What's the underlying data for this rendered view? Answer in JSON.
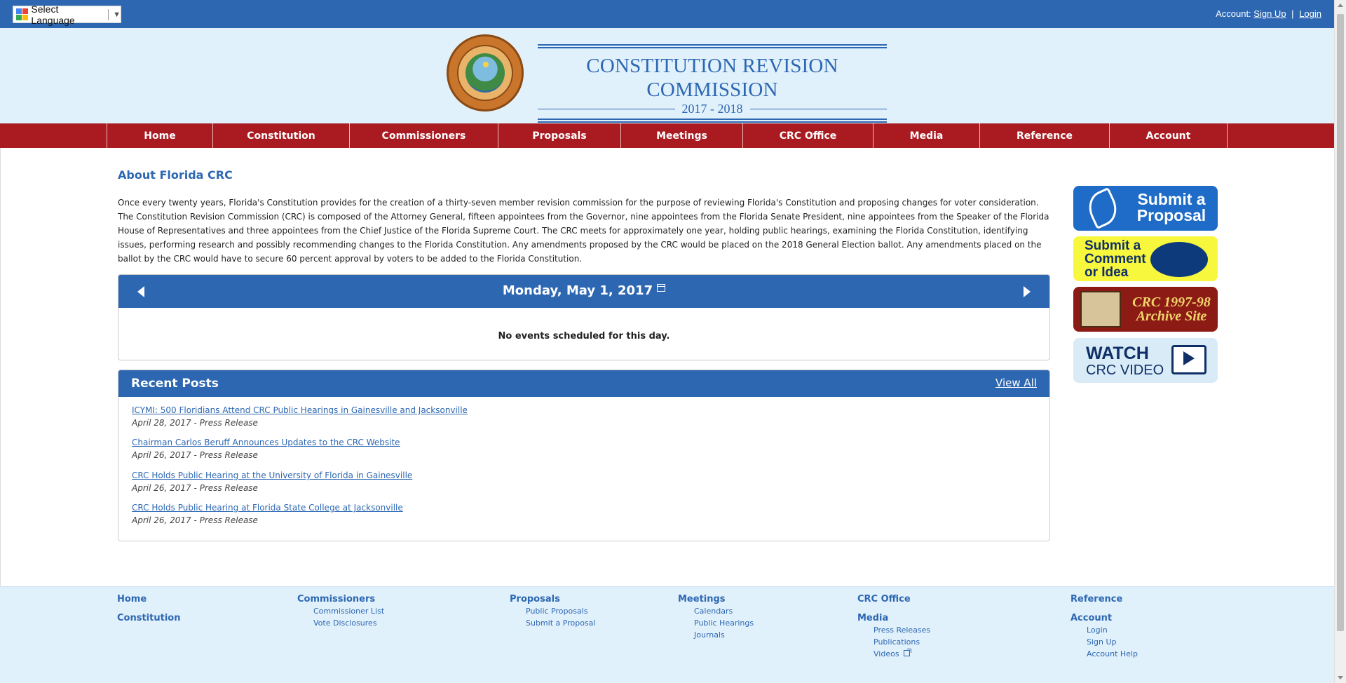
{
  "topbar": {
    "language_label": "Select Language",
    "account_label": "Account:",
    "signup": "Sign Up",
    "login": "Login",
    "separator": "|"
  },
  "header": {
    "title": "CONSTITUTION REVISION COMMISSION",
    "years": "2017 - 2018",
    "seal_text": "GREAT SEAL OF THE STATE OF FLORIDA · IN GOD WE TRUST"
  },
  "nav": [
    "Home",
    "Constitution",
    "Commissioners",
    "Proposals",
    "Meetings",
    "CRC Office",
    "Media",
    "Reference",
    "Account"
  ],
  "about": {
    "title": "About Florida CRC",
    "body": "Once every twenty years, Florida's Constitution provides for the creation of a thirty-seven member revision commission for the purpose of reviewing Florida's Constitution and proposing changes for voter consideration. The Constitution Revision Commission (CRC) is composed of the Attorney General, fifteen appointees from the Governor, nine appointees from the Florida Senate President, nine appointees from the Speaker of the Florida House of Representatives and three appointees from the Chief Justice of the Florida Supreme Court. The CRC meets for approximately one year, holding public hearings, examining the Florida Constitution, identifying issues, performing research and possibly recommending changes to the Florida Constitution. Any amendments proposed by the CRC would be placed on the 2018 General Election ballot. Any amendments placed on the ballot by the CRC would have to secure 60 percent approval by voters to be added to the Florida Constitution."
  },
  "calendar": {
    "date": "Monday, May 1, 2017",
    "empty_message": "No events scheduled for this day."
  },
  "recent_posts": {
    "title": "Recent Posts",
    "view_all": "View All",
    "items": [
      {
        "title": "ICYMI: 500 Floridians Attend CRC Public Hearings in Gainesville and Jacksonville",
        "meta": "April 28, 2017 - Press Release"
      },
      {
        "title": "Chairman Carlos Beruff Announces Updates to the CRC Website",
        "meta": "April 26, 2017 - Press Release"
      },
      {
        "title": "CRC Holds Public Hearing at the University of Florida in Gainesville",
        "meta": "April 26, 2017 - Press Release"
      },
      {
        "title": "CRC Holds Public Hearing at Florida State College at Jacksonville",
        "meta": "April 26, 2017 - Press Release"
      }
    ]
  },
  "sidebar": {
    "submit_proposal": "Submit a Proposal",
    "submit_comment": "Submit a Comment or Idea",
    "archive": "CRC 1997-98 Archive Site",
    "watch_1": "WATCH",
    "watch_2": "CRC VIDEO"
  },
  "footer": {
    "home": "Home",
    "constitution": "Constitution",
    "commissioners": {
      "head": "Commissioners",
      "items": [
        "Commissioner List",
        "Vote Disclosures"
      ]
    },
    "proposals": {
      "head": "Proposals",
      "items": [
        "Public Proposals",
        "Submit a Proposal"
      ]
    },
    "meetings": {
      "head": "Meetings",
      "items": [
        "Calendars",
        "Public Hearings",
        "Journals"
      ]
    },
    "crc_office": "CRC Office",
    "media": {
      "head": "Media",
      "items": [
        "Press Releases",
        "Publications",
        "Videos"
      ]
    },
    "reference": "Reference",
    "account": {
      "head": "Account",
      "items": [
        "Login",
        "Sign Up",
        "Account Help"
      ]
    }
  },
  "colors": {
    "brand_blue": "#2d67b2",
    "nav_red": "#a91b21",
    "header_bg": "#e1f1fb"
  }
}
